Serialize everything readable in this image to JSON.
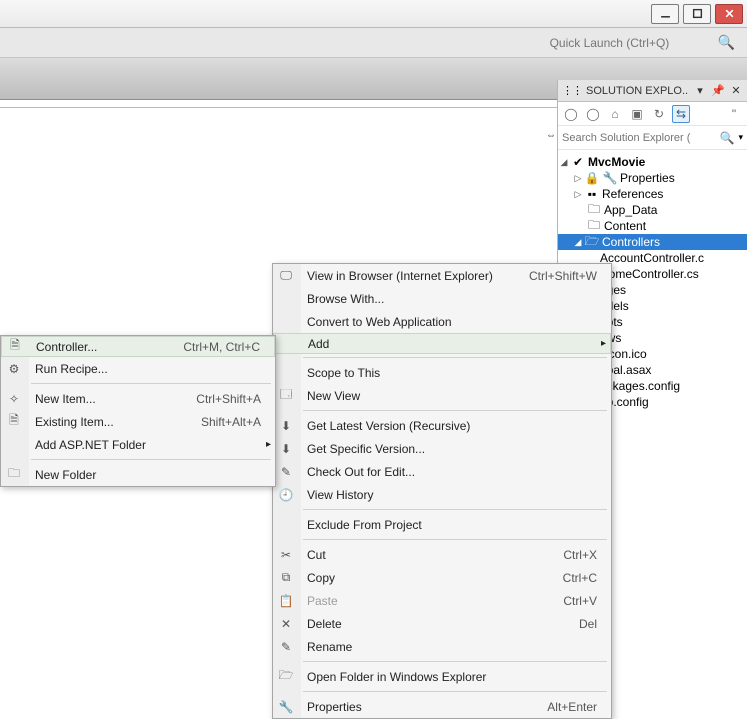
{
  "quicklaunch": {
    "placeholder": "Quick Launch (Ctrl+Q)"
  },
  "solution_explorer": {
    "title": "SOLUTION EXPLO...",
    "search_placeholder": "Search Solution Explorer (",
    "tree": {
      "root": "MvcMovie",
      "properties": "Properties",
      "references": "References",
      "app_data": "App_Data",
      "content": "Content",
      "controllers": "Controllers",
      "account_controller": "AccountController.c",
      "home_controller": "HomeController.cs",
      "images": "ages",
      "models": "odels",
      "scripts": "ripts",
      "views": "ews",
      "favicon": "vicon.ico",
      "global_asax": "obal.asax",
      "packages_config": "ackages.config",
      "web_config": "eb.config"
    }
  },
  "context_main": {
    "view_in_browser": "View in Browser (Internet Explorer)",
    "view_in_browser_shortcut": "Ctrl+Shift+W",
    "browse_with": "Browse With...",
    "convert": "Convert to Web Application",
    "add": "Add",
    "scope": "Scope to This",
    "new_view": "New View",
    "get_latest": "Get Latest Version (Recursive)",
    "get_specific": "Get Specific Version...",
    "check_out": "Check Out for Edit...",
    "view_history": "View History",
    "exclude": "Exclude From Project",
    "cut": "Cut",
    "cut_shortcut": "Ctrl+X",
    "copy": "Copy",
    "copy_shortcut": "Ctrl+C",
    "paste": "Paste",
    "paste_shortcut": "Ctrl+V",
    "delete": "Delete",
    "delete_shortcut": "Del",
    "rename": "Rename",
    "open_folder": "Open Folder in Windows Explorer",
    "properties": "Properties",
    "properties_shortcut": "Alt+Enter"
  },
  "context_sub": {
    "controller": "Controller...",
    "controller_shortcut": "Ctrl+M, Ctrl+C",
    "run_recipe": "Run Recipe...",
    "new_item": "New Item...",
    "new_item_shortcut": "Ctrl+Shift+A",
    "existing_item": "Existing Item...",
    "existing_item_shortcut": "Shift+Alt+A",
    "add_aspnet": "Add ASP.NET Folder",
    "new_folder": "New Folder"
  }
}
